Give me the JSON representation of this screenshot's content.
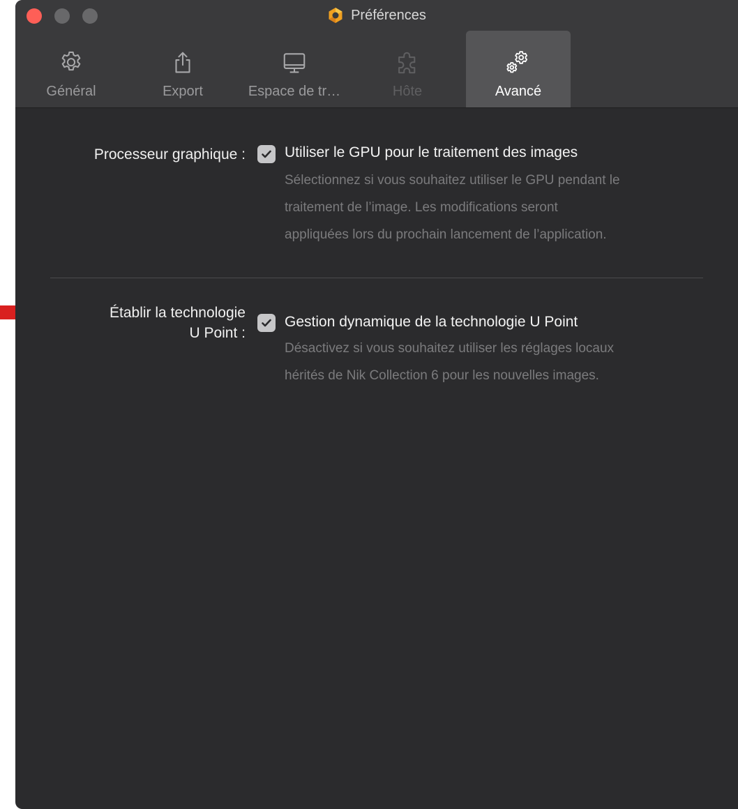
{
  "window": {
    "title": "Préférences"
  },
  "toolbar": {
    "tabs": [
      {
        "label": "Général",
        "icon": "gear-icon",
        "state": "normal"
      },
      {
        "label": "Export",
        "icon": "share-icon",
        "state": "normal"
      },
      {
        "label": "Espace de tr…",
        "icon": "monitor-icon",
        "state": "normal"
      },
      {
        "label": "Hôte",
        "icon": "puzzle-icon",
        "state": "disabled"
      },
      {
        "label": "Avancé",
        "icon": "gears-icon",
        "state": "active"
      }
    ]
  },
  "settings": {
    "gpu": {
      "label": "Processeur graphique :",
      "checked": true,
      "title": "Utiliser le GPU pour le traitement des images",
      "description_lines": [
        "Sélectionnez si vous souhaitez utiliser le GPU pendant le",
        "traitement de l’image. Les modifications seront",
        "appliquées lors du prochain lancement de l’application."
      ]
    },
    "upoint": {
      "label_lines": [
        "Établir la technologie",
        "U Point :"
      ],
      "checked": true,
      "title": "Gestion dynamique de la technologie U Point",
      "description_lines": [
        "Désactivez si vous souhaitez utiliser les réglages locaux",
        "hérités de Nik Collection 6 pour les nouvelles images."
      ]
    }
  },
  "colors": {
    "window_bg": "#2b2b2d",
    "toolbar_bg": "#3a3a3c",
    "active_tab_bg": "#555557",
    "close_button": "#fe5f57",
    "annotation_arrow": "#d9201f"
  }
}
